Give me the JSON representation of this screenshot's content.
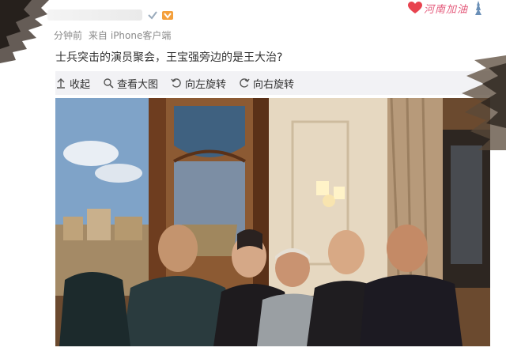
{
  "header": {
    "meta_time": "分钟前",
    "meta_from": "来自",
    "meta_client": "iPhone客户端"
  },
  "event_tag": {
    "text": "河南加油",
    "icon": "heart-icon"
  },
  "post": {
    "text": "士兵突击的演员聚会，王宝强旁边的是王大治?"
  },
  "toolbar": {
    "collapse_label": "收起",
    "view_large_label": "查看大图",
    "rotate_left_label": "向左旋转",
    "rotate_right_label": "向右旋转"
  },
  "colors": {
    "accent_pink": "#e45a7b",
    "toolbar_bg": "#f2f2f5",
    "meta_gray": "#8a8a8a",
    "text": "#333333"
  }
}
